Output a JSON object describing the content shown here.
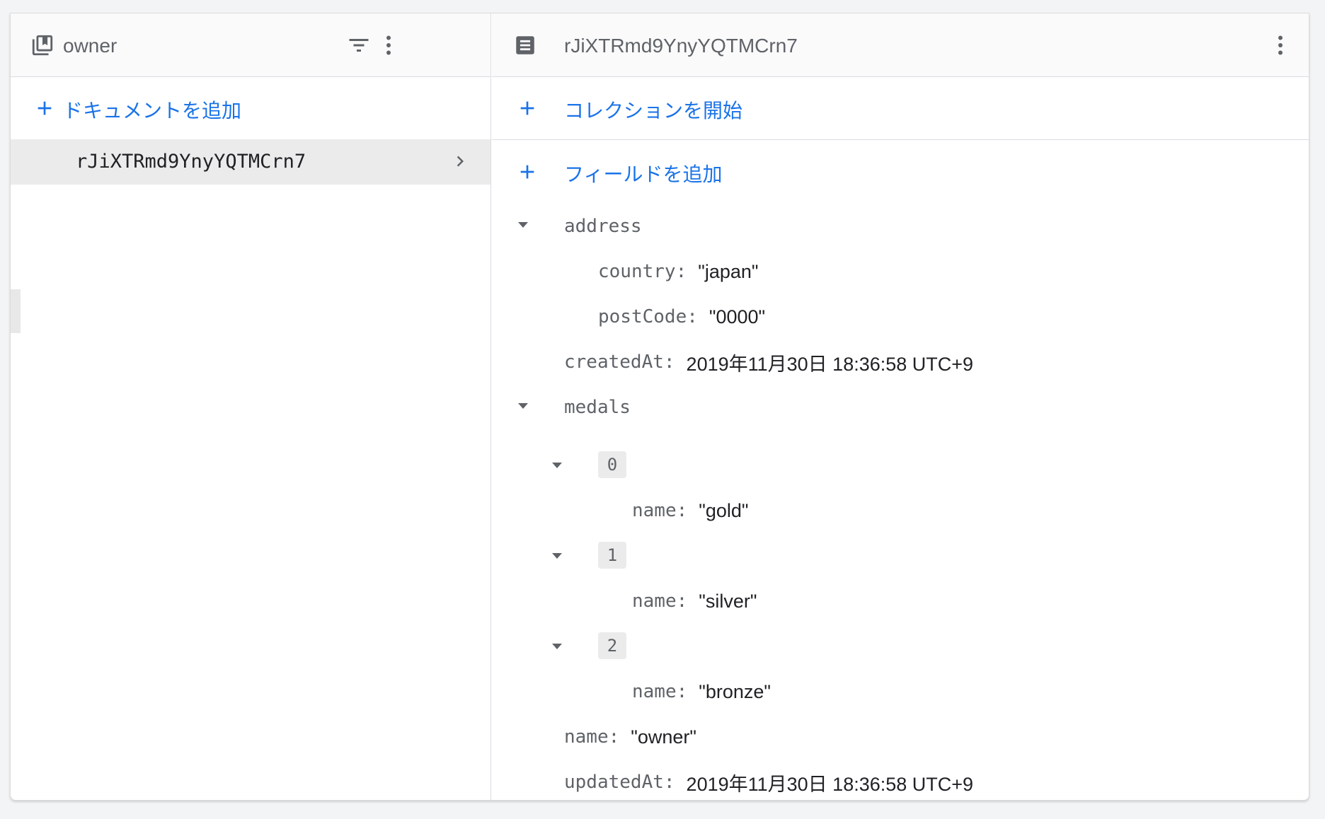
{
  "collection_panel": {
    "title": "owner",
    "add_document_label": "ドキュメントを追加",
    "documents": [
      "rJiXTRmd9YnyYQTMCrn7"
    ]
  },
  "document_panel": {
    "title": "rJiXTRmd9YnyYQTMCrn7",
    "start_collection_label": "コレクションを開始",
    "add_field_label": "フィールドを追加",
    "fields": {
      "address": {
        "key": "address",
        "country": {
          "key": "country",
          "value": "\"japan\""
        },
        "postCode": {
          "key": "postCode",
          "value": "\"0000\""
        }
      },
      "createdAt": {
        "key": "createdAt",
        "value": "2019年11月30日 18:36:58 UTC+9"
      },
      "medals": {
        "key": "medals",
        "items": [
          {
            "index": "0",
            "name_key": "name",
            "name_value": "\"gold\""
          },
          {
            "index": "1",
            "name_key": "name",
            "name_value": "\"silver\""
          },
          {
            "index": "2",
            "name_key": "name",
            "name_value": "\"bronze\""
          }
        ]
      },
      "name": {
        "key": "name",
        "value": "\"owner\""
      },
      "updatedAt": {
        "key": "updatedAt",
        "value": "2019年11月30日 18:36:58 UTC+9"
      }
    }
  },
  "colors": {
    "accent": "#1a73e8",
    "key_text": "#5f6368",
    "selected_row": "#ebebeb"
  },
  "icons": [
    "collection-icon",
    "filter-icon",
    "more-vert-icon",
    "document-icon",
    "plus-icon",
    "chevron-right-icon",
    "caret-down-icon"
  ]
}
